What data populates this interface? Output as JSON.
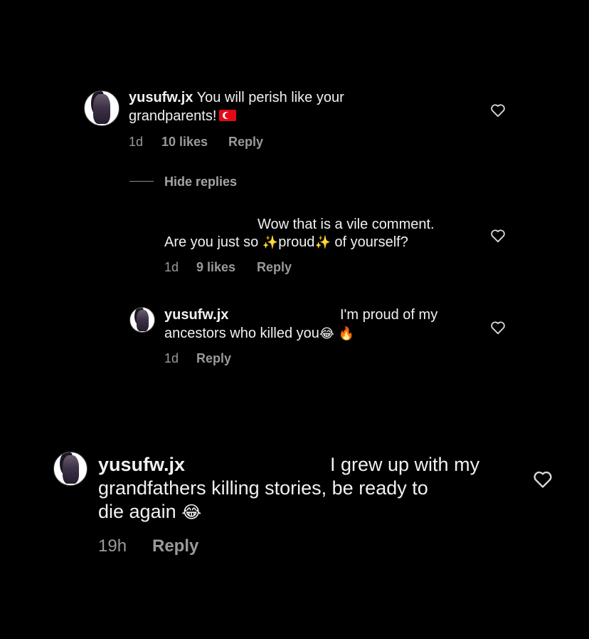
{
  "comments": [
    {
      "username": "yusufw.jx",
      "text_line1": "You will perish like your",
      "text_line2": "grandparents!",
      "time": "1d",
      "likes": "10 likes",
      "reply": "Reply"
    }
  ],
  "hide_replies": "Hide replies",
  "replies": [
    {
      "text_line1": "Wow that is a vile comment.",
      "text_line2_a": "Are you just so",
      "text_line2_b": "proud",
      "text_line2_c": "of yourself?",
      "time": "1d",
      "likes": "9 likes",
      "reply": "Reply"
    },
    {
      "username": "yusufw.jx",
      "text_line1": "I'm proud of my",
      "text_line2": "ancestors who killed you",
      "time": "1d",
      "reply": "Reply"
    }
  ],
  "bottom_comment": {
    "username": "yusufw.jx",
    "text_line1": "I grew up with my",
    "text_line2": "grandfathers killing stories, be ready to",
    "text_line3": "die again",
    "time": "19h",
    "reply": "Reply"
  },
  "icons": {
    "heart": "heart-icon",
    "sparkles": "sparkles-icon",
    "laugh": "laughing-emoji-icon",
    "fire": "fire-emoji-icon",
    "flag": "turkey-flag-icon"
  },
  "colors": {
    "background": "#000000",
    "text": "#f1f1f1",
    "muted": "#9a9a9a"
  }
}
